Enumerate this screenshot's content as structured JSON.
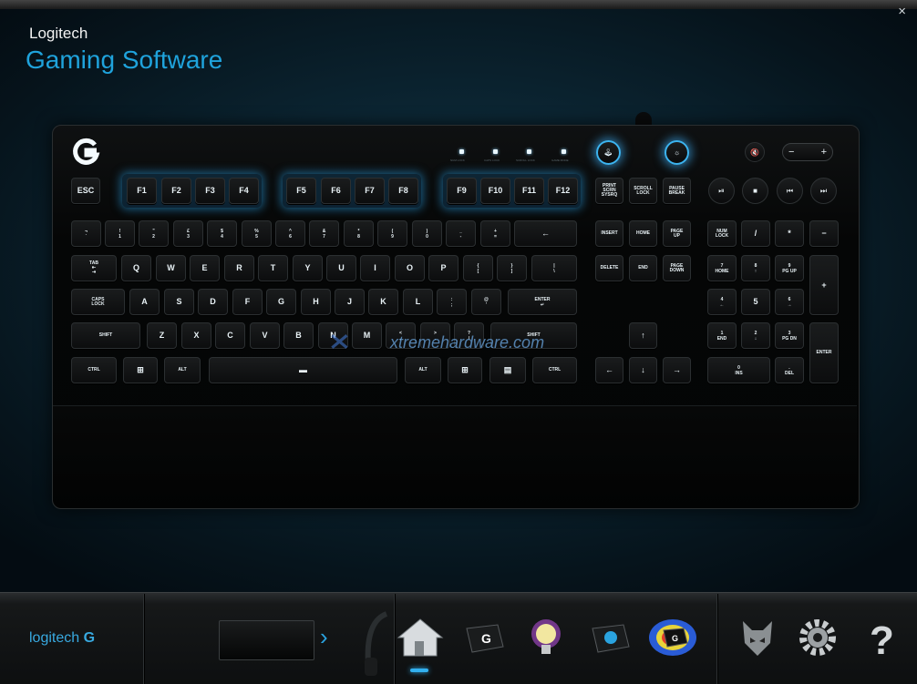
{
  "window": {
    "close_label": "×"
  },
  "header": {
    "brand": "Logitech",
    "title": "Gaming Software"
  },
  "indicators": {
    "labels": [
      "NUM LOCK",
      "CAPS LOCK",
      "SCROLL LOCK",
      "GAME MODE"
    ]
  },
  "keys": {
    "esc": "ESC",
    "f1": "F1",
    "f2": "F2",
    "f3": "F3",
    "f4": "F4",
    "f5": "F5",
    "f6": "F6",
    "f7": "F7",
    "f8": "F8",
    "f9": "F9",
    "f10": "F10",
    "f11": "F11",
    "f12": "F12",
    "prtsc": "PRINT\nSCRN\nSYSRQ",
    "scrlk": "SCROLL\nLOCK",
    "pause": "PAUSE\nBREAK",
    "tilde": "¬\n`",
    "k1": "!\n1",
    "k2": "\"\n2",
    "k3": "£\n3",
    "k4": "$\n4",
    "k5": "%\n5",
    "k6": "^\n6",
    "k7": "&\n7",
    "k8": "*\n8",
    "k9": "(\n9",
    "k0": ")\n0",
    "minus": "_\n-",
    "equals": "+\n=",
    "backspace": "←",
    "insert": "INSERT",
    "home": "HOME",
    "pgup": "PAGE\nUP",
    "numlock": "NUM\nLOCK",
    "ndiv": "/",
    "nmul": "*",
    "nsub": "−",
    "tab": "TAB\n⇤\n⇥",
    "q": "Q",
    "w": "W",
    "e": "E",
    "r": "R",
    "t": "T",
    "y": "Y",
    "u": "U",
    "i": "I",
    "o": "O",
    "p": "P",
    "lbrace": "{\n[",
    "rbrace": "}\n]",
    "bslash": "|\n\\",
    "delete": "DELETE",
    "end": "END",
    "pgdn": "PAGE\nDOWN",
    "n7": "7\nHOME",
    "n8": "8\n↑",
    "n9": "9\nPG UP",
    "nadd": "+",
    "caps": "CAPS\nLOCK",
    "a": "A",
    "s": "S",
    "d": "D",
    "f": "F",
    "g": "G",
    "h": "H",
    "j": "J",
    "k": "K",
    "l": "L",
    "semi": ":\n;",
    "quote": "@\n'",
    "hash": "~\n#",
    "enter": "ENTER\n↵",
    "n4": "4\n←",
    "n5": "5",
    "n6": "6\n→",
    "lshift": "SHIFT",
    "z": "Z",
    "x": "X",
    "c": "C",
    "v": "V",
    "b": "B",
    "n": "N",
    "m": "M",
    "comma": "<\n,",
    "period": ">\n.",
    "slash": "?\n/",
    "rshift": "SHIFT",
    "up": "↑",
    "n1": "1\nEND",
    "n2": "2\n↓",
    "n3": "3\nPG DN",
    "nenter": "ENTER",
    "lctrl": "CTRL",
    "lwin": "⊞",
    "lalt": "ALT",
    "space": "▬",
    "ralt": "ALT",
    "rwin": "⊞",
    "menu": "▤",
    "rctrl": "CTRL",
    "left": "←",
    "down": "↓",
    "right": "→",
    "n0": "0\nINS",
    "ndot": ".\nDEL"
  },
  "media": {
    "prev": "⏮",
    "stop": "■",
    "playpause": "⏯",
    "next": "⏭",
    "mute": "🔇",
    "vol_minus": "−",
    "vol_plus": "+",
    "game_mode": "🕹",
    "backlight": "☼"
  },
  "watermark": {
    "text": "xtremehardware.com"
  },
  "bottom": {
    "logo": "logitech",
    "next_arrow": "›"
  },
  "colors": {
    "accent": "#1fa3dc",
    "glow": "#3cb4f0",
    "background": "#0b2431"
  }
}
